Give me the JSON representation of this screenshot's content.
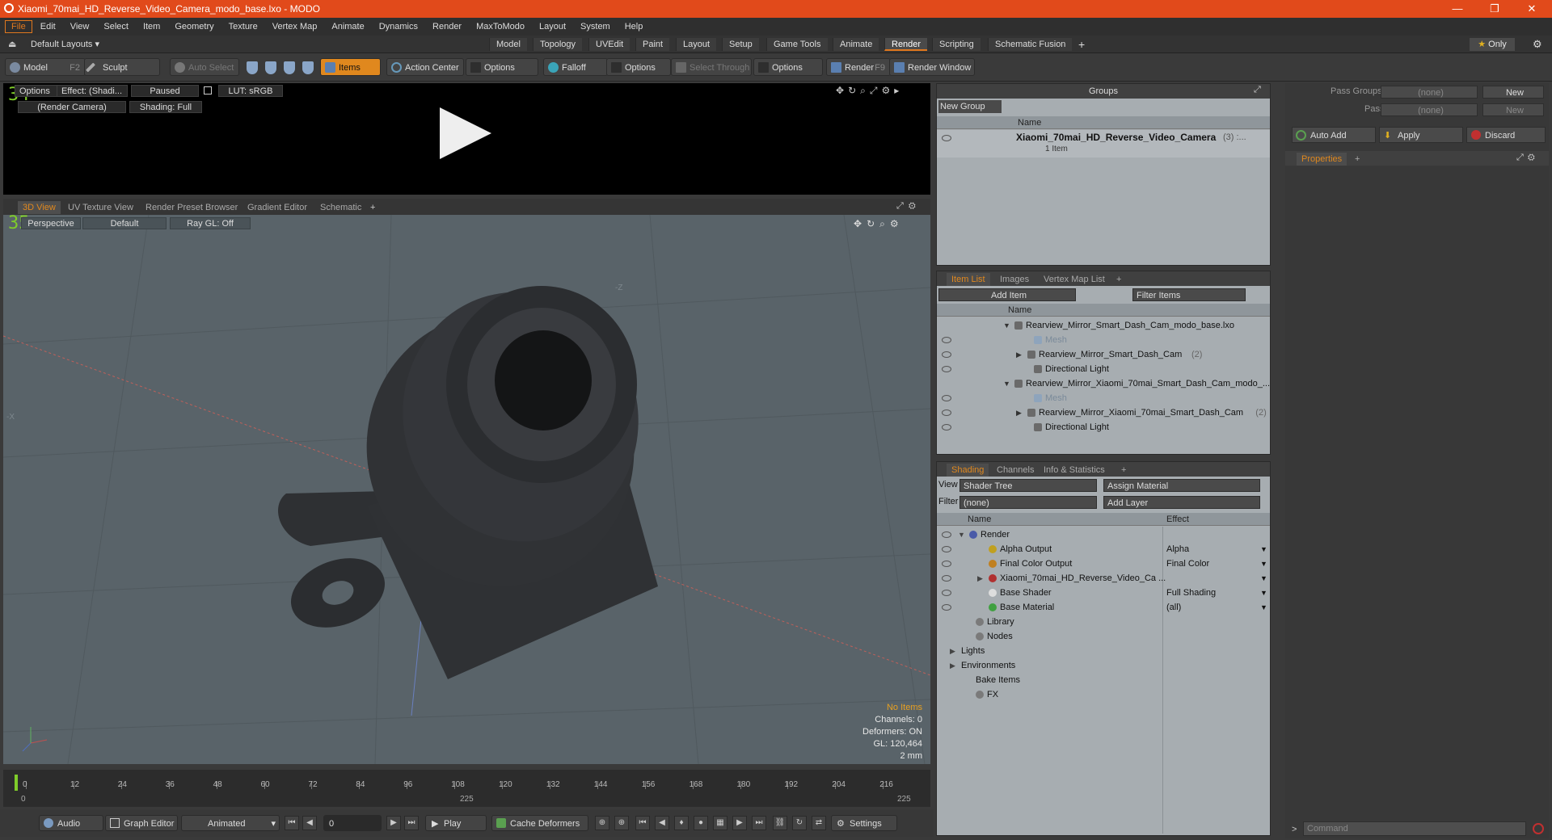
{
  "window": {
    "title": "Xiaomi_70mai_HD_Reverse_Video_Camera_modo_base.lxo - MODO",
    "minimize": "—",
    "maximize": "❐",
    "close": "✕"
  },
  "menu": [
    "File",
    "Edit",
    "View",
    "Select",
    "Item",
    "Geometry",
    "Texture",
    "Vertex Map",
    "Animate",
    "Dynamics",
    "Render",
    "MaxToModo",
    "Layout",
    "System",
    "Help"
  ],
  "layouts": {
    "default": "Default Layouts ▾",
    "tabs": [
      "Model",
      "Topology",
      "UVEdit",
      "Paint",
      "Layout",
      "Setup",
      "Game Tools",
      "Animate",
      "Render",
      "Scripting",
      "Schematic Fusion"
    ],
    "active": "Render",
    "add": "+",
    "only": "Only"
  },
  "toolbar": {
    "model": "Model",
    "model_key": "F2",
    "sculpt": "Sculpt",
    "auto_select": "Auto Select",
    "items": "Items",
    "action_center": "Action Center",
    "options1": "Options",
    "falloff": "Falloff",
    "options2": "Options",
    "select_through": "Select Through",
    "options3": "Options",
    "render": "Render",
    "render_key": "F9",
    "render_window": "Render Window"
  },
  "render_view": {
    "num": "34",
    "options": "Options",
    "effect": "Effect: (Shadi...",
    "paused": "Paused",
    "lut": "LUT: sRGB",
    "camera": "(Render Camera)",
    "shading": "Shading: Full"
  },
  "viewport_tabs": [
    "3D View",
    "UV Texture View",
    "Render Preset Browser",
    "Gradient Editor",
    "Schematic"
  ],
  "viewport": {
    "num": "35",
    "perspective": "Perspective",
    "default": "Default",
    "raygl": "Ray GL: Off",
    "axis_z": "-Z",
    "axis_x": "-X",
    "info": {
      "no_items": "No Items",
      "channels": "Channels: 0",
      "deformers": "Deformers: ON",
      "gl": "GL: 120,464",
      "scale": "2 mm"
    }
  },
  "timeline": {
    "ticks": [
      "0",
      "12",
      "24",
      "36",
      "48",
      "60",
      "72",
      "84",
      "96",
      "108",
      "120",
      "132",
      "144",
      "156",
      "168",
      "180",
      "192",
      "204",
      "216"
    ],
    "start": "0",
    "mid": "225",
    "end": "225"
  },
  "bottombar": {
    "audio": "Audio",
    "graph_editor": "Graph Editor",
    "animated": "Animated",
    "frame": "0",
    "play": "Play",
    "cache_deformers": "Cache Deformers",
    "settings": "Settings"
  },
  "groups": {
    "title": "Groups",
    "new_group": "New Group",
    "col_name": "Name",
    "item_name": "Xiaomi_70mai_HD_Reverse_Video_Camera",
    "item_count": "(3) :...",
    "item_sub": "1 Item"
  },
  "item_list": {
    "tabs": [
      "Item List",
      "Images",
      "Vertex Map List"
    ],
    "add_item": "Add Item",
    "filter": "Filter Items",
    "col_name": "Name",
    "rows": [
      {
        "label": "Rearview_Mirror_Smart_Dash_Cam_modo_base.lxo",
        "indent": 0,
        "dim": false,
        "count": ""
      },
      {
        "label": "Mesh",
        "indent": 2,
        "dim": true,
        "count": ""
      },
      {
        "label": "Rearview_Mirror_Smart_Dash_Cam",
        "indent": 1,
        "dim": false,
        "count": "(2)"
      },
      {
        "label": "Directional Light",
        "indent": 2,
        "dim": false,
        "count": ""
      },
      {
        "label": "Rearview_Mirror_Xiaomi_70mai_Smart_Dash_Cam_modo_...",
        "indent": 0,
        "dim": false,
        "count": ""
      },
      {
        "label": "Mesh",
        "indent": 2,
        "dim": true,
        "count": ""
      },
      {
        "label": "Rearview_Mirror_Xiaomi_70mai_Smart_Dash_Cam",
        "indent": 1,
        "dim": false,
        "count": "(2)"
      },
      {
        "label": "Directional Light",
        "indent": 2,
        "dim": false,
        "count": ""
      }
    ]
  },
  "shading": {
    "tabs": [
      "Shading",
      "Channels",
      "Info & Statistics"
    ],
    "view_label": "View",
    "view_value": "Shader Tree",
    "assign": "Assign Material",
    "filter_label": "Filter",
    "filter_value": "(none)",
    "add_layer": "Add Layer",
    "col_name": "Name",
    "col_effect": "Effect",
    "rows": [
      {
        "label": "Render",
        "effect": ""
      },
      {
        "label": "Alpha Output",
        "effect": "Alpha"
      },
      {
        "label": "Final Color Output",
        "effect": "Final Color"
      },
      {
        "label": "Xiaomi_70mai_HD_Reverse_Video_Ca ...",
        "effect": ""
      },
      {
        "label": "Base Shader",
        "effect": "Full Shading"
      },
      {
        "label": "Base Material",
        "effect": "(all)"
      },
      {
        "label": "Library",
        "effect": ""
      },
      {
        "label": "Nodes",
        "effect": ""
      },
      {
        "label": "Lights",
        "effect": ""
      },
      {
        "label": "Environments",
        "effect": ""
      },
      {
        "label": "Bake Items",
        "effect": ""
      },
      {
        "label": "FX",
        "effect": ""
      }
    ]
  },
  "right": {
    "pass_groups": "Pass Groups",
    "passes": "Passes",
    "none": "(none)",
    "new": "New",
    "auto_add": "Auto Add",
    "apply": "Apply",
    "discard": "Discard",
    "properties": "Properties",
    "command": "Command"
  },
  "colors": {
    "accent": "#e0881e",
    "titlebar": "#e14a1b",
    "viewport": "#596369"
  }
}
